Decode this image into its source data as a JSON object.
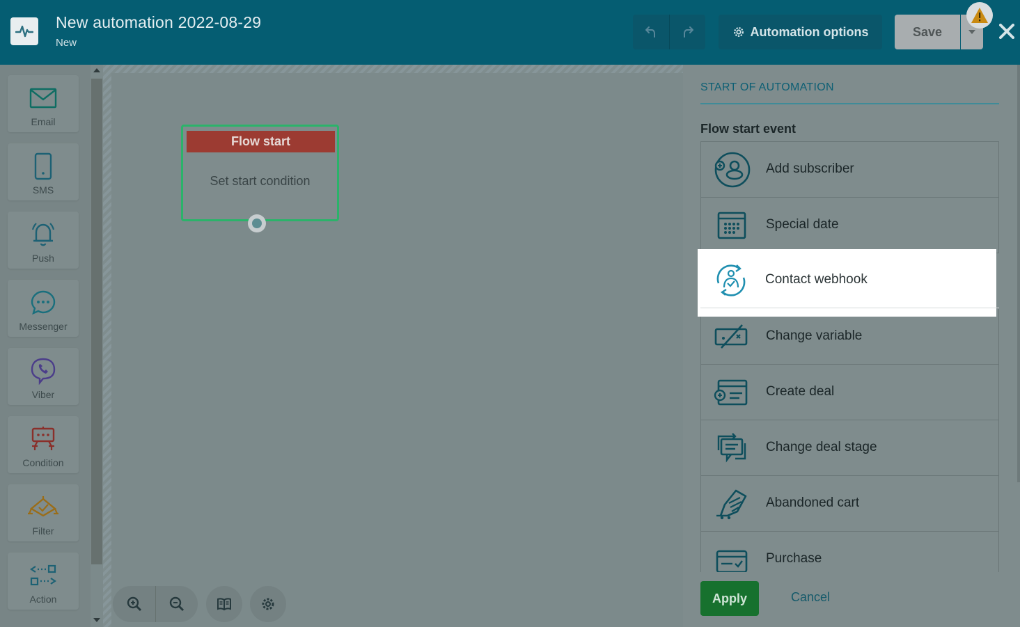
{
  "header": {
    "title": "New automation 2022-08-29",
    "subtitle": "New",
    "options_label": "Automation options",
    "save_label": "Save"
  },
  "palette": {
    "items": [
      {
        "label": "Email",
        "icon": "envelope-icon"
      },
      {
        "label": "SMS",
        "icon": "mobile-phone-icon"
      },
      {
        "label": "Push",
        "icon": "bell-icon"
      },
      {
        "label": "Messenger",
        "icon": "chat-bubble-icon"
      },
      {
        "label": "Viber",
        "icon": "viber-icon"
      },
      {
        "label": "Condition",
        "icon": "condition-icon"
      },
      {
        "label": "Filter",
        "icon": "filter-icon"
      },
      {
        "label": "Action",
        "icon": "action-icon"
      }
    ]
  },
  "canvas": {
    "node_title": "Flow start",
    "node_body": "Set start condition"
  },
  "panel": {
    "title": "START OF AUTOMATION",
    "event_label": "Flow start event",
    "events": [
      {
        "label": "Add subscriber",
        "icon": "add-subscriber-icon"
      },
      {
        "label": "Special date",
        "icon": "calendar-icon"
      },
      {
        "label": "Contact webhook",
        "icon": "contact-webhook-icon"
      },
      {
        "label": "Change variable",
        "icon": "change-variable-icon"
      },
      {
        "label": "Create deal",
        "icon": "create-deal-icon"
      },
      {
        "label": "Change deal stage",
        "icon": "change-deal-stage-icon"
      },
      {
        "label": "Abandoned cart",
        "icon": "abandoned-cart-icon"
      },
      {
        "label": "Purchase",
        "icon": "purchase-icon"
      }
    ],
    "apply_label": "Apply",
    "cancel_label": "Cancel"
  },
  "colors": {
    "header_bg": "#055d72",
    "accent": "#0d5f74",
    "flow_head": "#9c3b32",
    "flow_border": "#2bb36a",
    "apply_bg": "#17712e"
  }
}
